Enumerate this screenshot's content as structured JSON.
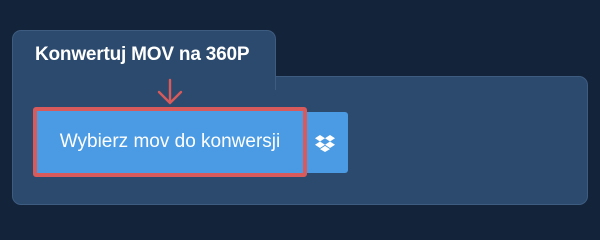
{
  "panel": {
    "title": "Konwertuj MOV na 360P"
  },
  "upload": {
    "choose_label": "Wybierz mov do konwersji",
    "dropbox_icon": "dropbox-icon",
    "arrow_icon": "arrow-down-icon"
  },
  "colors": {
    "page_background": "#13233a",
    "panel_background": "#2c4a6d",
    "button_blue": "#4a9be4",
    "highlight_red": "#d85a5a"
  }
}
